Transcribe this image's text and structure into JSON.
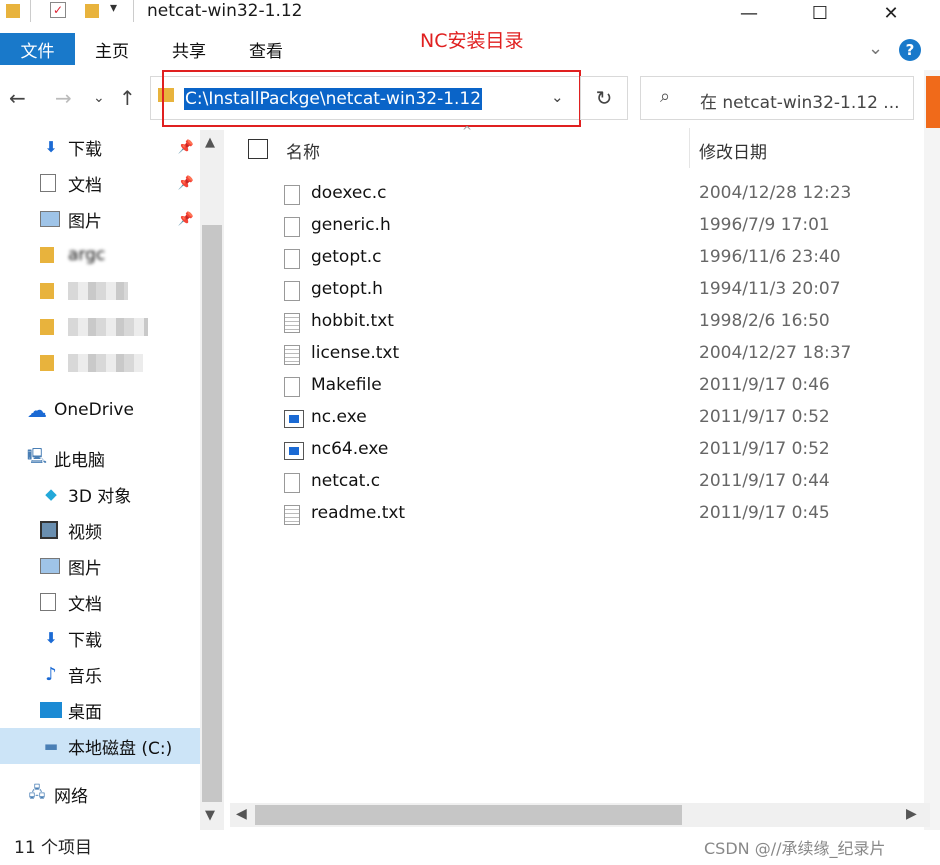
{
  "window": {
    "title": "netcat-win32-1.12"
  },
  "ribbon": {
    "tabs": [
      "文件",
      "主页",
      "共享",
      "查看"
    ]
  },
  "annotation": "NC安装目录",
  "address": {
    "path": "C:\\InstallPackge\\netcat-win32-1.12"
  },
  "search": {
    "placeholder": "在 netcat-win32-1.12 ..."
  },
  "sidebar": {
    "quick_access": [
      "下载",
      "文档",
      "图片"
    ],
    "blurred_item_1": "argc",
    "onedrive": "OneDrive",
    "this_pc": "此电脑",
    "pc_items": [
      "3D 对象",
      "视频",
      "图片",
      "文档",
      "下载",
      "音乐",
      "桌面",
      "本地磁盘 (C:)"
    ],
    "network": "网络"
  },
  "columns": {
    "name": "名称",
    "modified": "修改日期"
  },
  "files": [
    {
      "name": "doexec.c",
      "date": "2004/12/28 12:23",
      "icon": "file-icon"
    },
    {
      "name": "generic.h",
      "date": "1996/7/9 17:01",
      "icon": "file-icon"
    },
    {
      "name": "getopt.c",
      "date": "1996/11/6 23:40",
      "icon": "file-icon"
    },
    {
      "name": "getopt.h",
      "date": "1994/11/3 20:07",
      "icon": "file-icon"
    },
    {
      "name": "hobbit.txt",
      "date": "1998/2/6 16:50",
      "icon": "text-file-icon"
    },
    {
      "name": "license.txt",
      "date": "2004/12/27 18:37",
      "icon": "text-file-icon"
    },
    {
      "name": "Makefile",
      "date": "2011/9/17 0:46",
      "icon": "file-icon"
    },
    {
      "name": "nc.exe",
      "date": "2011/9/17 0:52",
      "icon": "exe-icon"
    },
    {
      "name": "nc64.exe",
      "date": "2011/9/17 0:52",
      "icon": "exe-icon"
    },
    {
      "name": "netcat.c",
      "date": "2011/9/17 0:44",
      "icon": "file-icon"
    },
    {
      "name": "readme.txt",
      "date": "2011/9/17 0:45",
      "icon": "text-file-icon"
    }
  ],
  "status": {
    "count": "11 个项目"
  },
  "watermark": "CSDN @//承续缘_纪录片",
  "colors": {
    "accent": "#1979ca",
    "selection": "#0a64c8",
    "annotation": "#e02020"
  }
}
